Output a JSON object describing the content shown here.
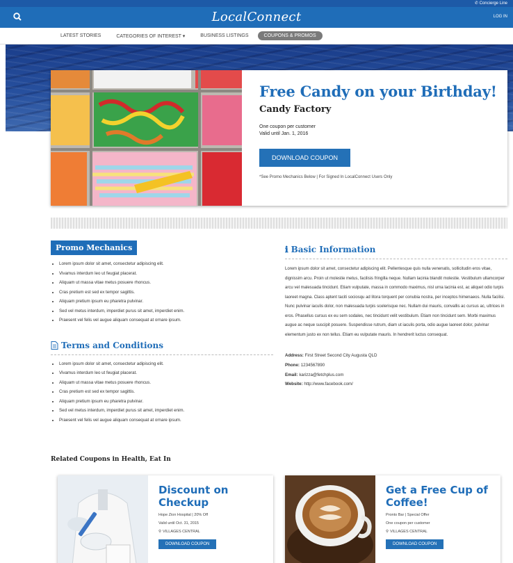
{
  "utility": {
    "concierge": "Concierge Line"
  },
  "header": {
    "logo": "LocalConnect",
    "login": "LOG IN"
  },
  "nav": [
    {
      "label": "LATEST STORIES"
    },
    {
      "label": "CATEGORIES OF INTEREST ▾"
    },
    {
      "label": "BUSINESS LISTINGS"
    },
    {
      "label": "COUPONS & PROMOS",
      "active": true
    }
  ],
  "hero": {
    "title": "Free Candy on your Birthday!",
    "merchant": "Candy Factory",
    "limit": "One coupon per customer",
    "valid": "Valid until Jan. 1, 2016",
    "button": "DOWNLOAD COUPON",
    "note": "*See Promo Mechanics Below | For Signed In LocalConnect Users Only"
  },
  "promo": {
    "heading": "Promo Mechanics",
    "items": [
      "Lorem ipsum dolor sit amet, consectetur adipiscing elit.",
      "Vivamus interdum leo ut feugiat placerat.",
      "Aliquam ut massa vitae metus posuere rhoncus.",
      "Cras pretium est sed ex tempor sagittis.",
      "Aliquam pretium ipsum eu pharetra pulvinar.",
      "Sed vel metus interdum, imperdiet purus sit amet, imperdiet enim.",
      "Praesent vel felis vel augue aliquam consequat at ornare ipsum."
    ]
  },
  "terms": {
    "heading": "Terms and Conditions",
    "items": [
      "Lorem ipsum dolor sit amet, consectetur adipiscing elit.",
      "Vivamus interdum leo ut feugiat placerat.",
      "Aliquam ut massa vitae metus posuere rhoncus.",
      "Cras pretium est sed ex tempor sagittis.",
      "Aliquam pretium ipsum eu pharetra pulvinar.",
      "Sed vel metus interdum, imperdiet purus sit amet, imperdiet enim.",
      "Praesent vel felis vel augue aliquam consequat at ornare ipsum."
    ]
  },
  "basic": {
    "heading": "Basic Information",
    "paragraph": "Lorem ipsum dolor sit amet, consectetur adipiscing elit. Pellentesque quis nulla venenatis, sollicitudin eros vitae, dignissim arcu. Proin ut molestie metus, facilisis fringilla neque. Nullam lacinia blandit molestie. Vestibulum ullamcorper arcu vel malesuada tincidunt. Etiam vulputate, massa in commodo maximus, nisl urna lacinia est, ac aliquet odio turpis laoreet magna. Class aptent taciti sociosqu ad litora torquent per conubia nostra, per inceptos himenaeos. Nulla facilisi. Nunc pulvinar iaculis dolor, non malesuada turpis scelerisque nec. Nullam dui mauris, convallis ac cursus ac, ultrices in eros. Phasellus cursus ex eu sem sodales, nec tincidunt velit vestibulum. Etiam non tincidunt sem. Morbi maximus augue ac neque suscipit posuere. Suspendisse rutrum, diam ut iaculis porta, odio augue laoreet dolor, pulvinar elementum justo ex non tellus. Etiam eu vulputate mauris. In hendrerit luctus consequat.",
    "address_label": "Address:",
    "address": "First Street Second City Augusta QLD",
    "phone_label": "Phone:",
    "phone": "1234567890",
    "email_label": "Email:",
    "email": "karizza@fetchplus.com",
    "website_label": "Website:",
    "website": "http://www.facebook.com/"
  },
  "related": {
    "heading": "Related Coupons in Health, Eat In",
    "cards": [
      {
        "title": "Discount on Checkup",
        "meta": "Hope Zion Hospital | 20% Off",
        "valid": "Valid until Oct. 31, 2015",
        "location": "VILLAGES CENTRAL",
        "button": "DOWNLOAD COUPON"
      },
      {
        "title": "Get a Free Cup of Coffee!",
        "meta": "Pronto Bar | Special Offer",
        "valid": "One coupon per customer",
        "location": "VILLAGES CENTRAL",
        "button": "DOWNLOAD COUPON"
      }
    ]
  },
  "colors": {
    "brand": "#1f6db8",
    "utility": "#1d5aa7",
    "button": "#2471b7"
  }
}
